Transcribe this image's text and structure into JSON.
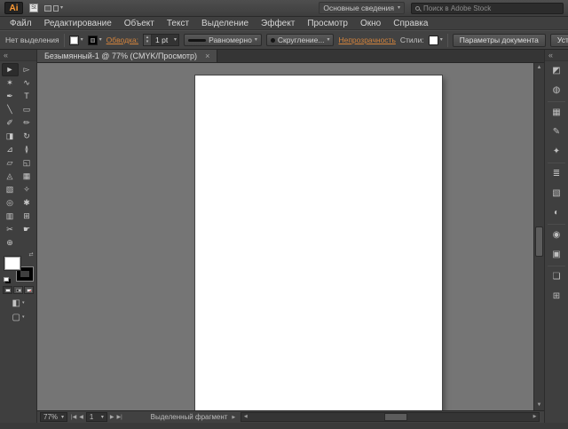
{
  "title_bar": {
    "logo": "Ai",
    "stock_icon": "St",
    "workspace_switcher": "Основные сведения",
    "search_placeholder": "Поиск в Adobe Stock"
  },
  "menu_bar": {
    "items": [
      {
        "name": "menu-file",
        "label": "Файл"
      },
      {
        "name": "menu-edit",
        "label": "Редактирование"
      },
      {
        "name": "menu-object",
        "label": "Объект"
      },
      {
        "name": "menu-type",
        "label": "Текст"
      },
      {
        "name": "menu-select",
        "label": "Выделение"
      },
      {
        "name": "menu-effect",
        "label": "Эффект"
      },
      {
        "name": "menu-view",
        "label": "Просмотр"
      },
      {
        "name": "menu-window",
        "label": "Окно"
      },
      {
        "name": "menu-help",
        "label": "Справка"
      }
    ]
  },
  "control_bar": {
    "selection_label": "Нет выделения",
    "stroke_link": "Обводка:",
    "stroke_width": "1 pt",
    "width_profile": "Равномерно",
    "brush_definition": "Скругление...",
    "opacity_link": "Непрозрачность",
    "styles_label": "Стили:",
    "document_setup_button": "Параметры документа",
    "preferences_button": "Установки"
  },
  "document_tab": {
    "title": "Безымянный-1 @ 77% (CMYK/Просмотр)",
    "close": "×"
  },
  "toolbar": {
    "collapse": "«",
    "tools": [
      {
        "name": "selection-tool",
        "glyph": "►",
        "selected": true
      },
      {
        "name": "direct-selection-tool",
        "glyph": "▻"
      },
      {
        "name": "magic-wand-tool",
        "glyph": "✶"
      },
      {
        "name": "lasso-tool",
        "glyph": "∿"
      },
      {
        "name": "pen-tool",
        "glyph": "✒"
      },
      {
        "name": "type-tool",
        "glyph": "T"
      },
      {
        "name": "line-segment-tool",
        "glyph": "╲"
      },
      {
        "name": "rectangle-tool",
        "glyph": "▭"
      },
      {
        "name": "paintbrush-tool",
        "glyph": "✐"
      },
      {
        "name": "pencil-tool",
        "glyph": "✏"
      },
      {
        "name": "eraser-tool",
        "glyph": "◨"
      },
      {
        "name": "rotate-tool",
        "glyph": "↻"
      },
      {
        "name": "scale-tool",
        "glyph": "⊿"
      },
      {
        "name": "width-tool",
        "glyph": "≬"
      },
      {
        "name": "free-transform-tool",
        "glyph": "▱"
      },
      {
        "name": "shape-builder-tool",
        "glyph": "◱"
      },
      {
        "name": "perspective-grid-tool",
        "glyph": "◬"
      },
      {
        "name": "mesh-tool",
        "glyph": "▦"
      },
      {
        "name": "gradient-tool",
        "glyph": "▧"
      },
      {
        "name": "eyedropper-tool",
        "glyph": "✧"
      },
      {
        "name": "blend-tool",
        "glyph": "◎"
      },
      {
        "name": "symbol-sprayer-tool",
        "glyph": "✱"
      },
      {
        "name": "column-graph-tool",
        "glyph": "▥"
      },
      {
        "name": "artboard-tool",
        "glyph": "⊞"
      },
      {
        "name": "slice-tool",
        "glyph": "✂"
      },
      {
        "name": "hand-tool",
        "glyph": "☛"
      },
      {
        "name": "zoom-tool",
        "glyph": "⊕"
      }
    ]
  },
  "dock": {
    "collapse": "«",
    "icons": [
      {
        "name": "color-panel-icon",
        "glyph": "◩"
      },
      {
        "name": "color-guide-panel-icon",
        "glyph": "◍",
        "sep_after": true
      },
      {
        "name": "swatches-panel-icon",
        "glyph": "▦"
      },
      {
        "name": "brushes-panel-icon",
        "glyph": "✎"
      },
      {
        "name": "symbols-panel-icon",
        "glyph": "✦",
        "sep_after": true
      },
      {
        "name": "stroke-panel-icon",
        "glyph": "≣"
      },
      {
        "name": "gradient-panel-icon",
        "glyph": "▧"
      },
      {
        "name": "transparency-panel-icon",
        "glyph": "◐",
        "sep_after": true
      },
      {
        "name": "appearance-panel-icon",
        "glyph": "◉"
      },
      {
        "name": "graphic-styles-panel-icon",
        "glyph": "▣",
        "sep_after": true
      },
      {
        "name": "layers-panel-icon",
        "glyph": "❏"
      },
      {
        "name": "artboards-panel-icon",
        "glyph": "⊞"
      }
    ]
  },
  "status_bar": {
    "zoom": "77%",
    "artboard_number": "1",
    "status_text": "Выделенный фрагмент"
  },
  "colors": {
    "link_orange": "#d2833c",
    "canvas_gray": "#757575",
    "logo_orange": "#ff9a33"
  }
}
